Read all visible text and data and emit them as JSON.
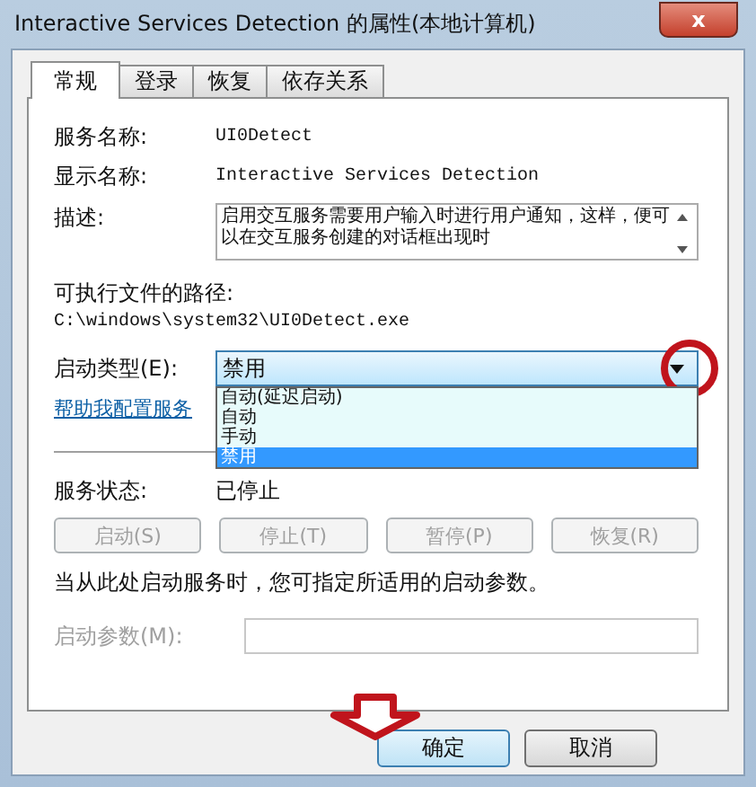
{
  "window": {
    "title": "Interactive Services Detection 的属性(本地计算机)",
    "close": "x"
  },
  "tabs": [
    {
      "label": "常规",
      "selected": true
    },
    {
      "label": "登录",
      "selected": false
    },
    {
      "label": "恢复",
      "selected": false
    },
    {
      "label": "依存关系",
      "selected": false
    }
  ],
  "fields": [
    {
      "label": "服务名称:",
      "value": "UI0Detect"
    },
    {
      "label": "显示名称:",
      "value": "Interactive Services Detection"
    }
  ],
  "description": {
    "label": "描述:",
    "value": "启用交互服务需要用户输入时进行用户通知，这样，便可以在交互服务创建的对话框出现时"
  },
  "path": {
    "label": "可执行文件的路径:",
    "value": "C:\\windows\\system32\\UI0Detect.exe"
  },
  "startup_type": {
    "label": "启动类型(E):",
    "value": "禁用",
    "expanded": true,
    "options": [
      {
        "label": "自动(延迟启动)",
        "selected": false
      },
      {
        "label": "自动",
        "selected": false
      },
      {
        "label": "手动",
        "selected": false
      },
      {
        "label": "禁用",
        "selected": true
      }
    ]
  },
  "help_link": "帮助我配置服务",
  "service_status": {
    "label": "服务状态:",
    "value": "已停止"
  },
  "service_buttons": [
    {
      "label": "启动(S)",
      "disabled": true
    },
    {
      "label": "停止(T)",
      "disabled": true
    },
    {
      "label": "暂停(P)",
      "disabled": true
    },
    {
      "label": "恢复(R)",
      "disabled": true
    }
  ],
  "hint": "当从此处启动服务时，您可指定所适用的启动参数。",
  "start_params": {
    "label": "启动参数(M):",
    "disabled": true
  },
  "dialog_buttons": [
    {
      "label": "确定",
      "default": true
    },
    {
      "label": "取消",
      "default": false
    }
  ]
}
